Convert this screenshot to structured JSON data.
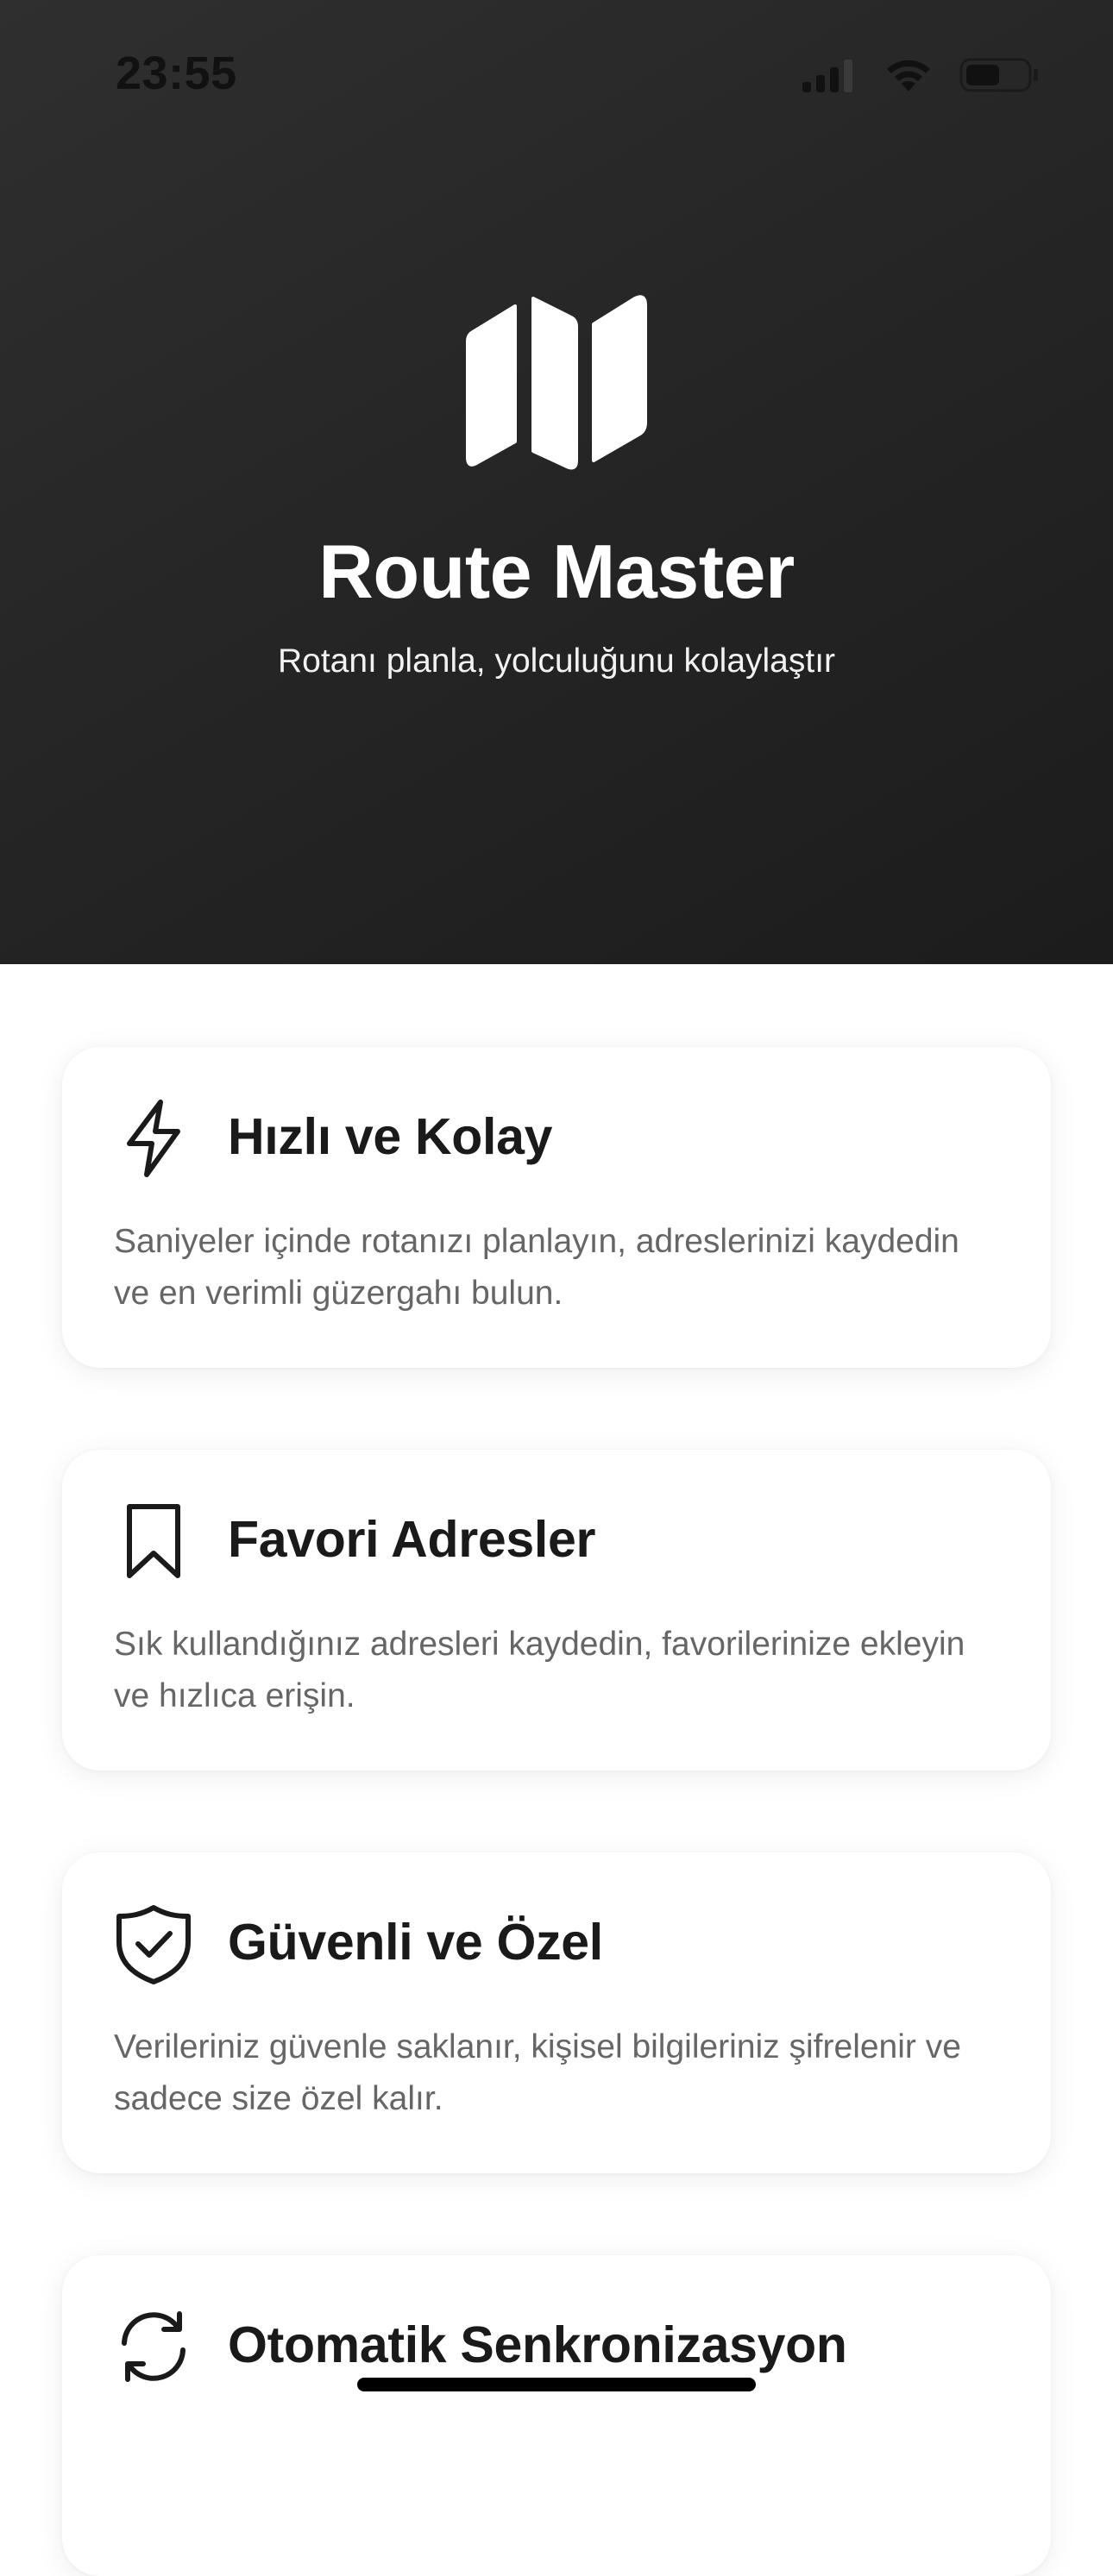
{
  "status_bar": {
    "time": "23:55",
    "signal_icon": "cellular-signal-icon",
    "wifi_icon": "wifi-icon",
    "battery_icon": "battery-icon"
  },
  "hero": {
    "logo_icon": "map-icon",
    "title": "Route Master",
    "subtitle": "Rotanı planla, yolculuğunu kolaylaştır",
    "background_color": "#262626"
  },
  "features": [
    {
      "icon": "lightning-icon",
      "title": "Hızlı ve Kolay",
      "description": "Saniyeler içinde rotanızı planlayın, adreslerinizi kaydedin ve en verimli güzergahı bulun."
    },
    {
      "icon": "bookmark-icon",
      "title": "Favori Adresler",
      "description": "Sık kullandığınız adresleri kaydedin, favorilerinize ekleyin ve hızlıca erişin."
    },
    {
      "icon": "shield-check-icon",
      "title": "Güvenli ve Özel",
      "description": "Verileriniz güvenle saklanır, kişisel bilgileriniz şifrelenir ve sadece size özel kalır."
    },
    {
      "icon": "sync-icon",
      "title": "Otomatik Senkronizasyon",
      "description": ""
    }
  ]
}
